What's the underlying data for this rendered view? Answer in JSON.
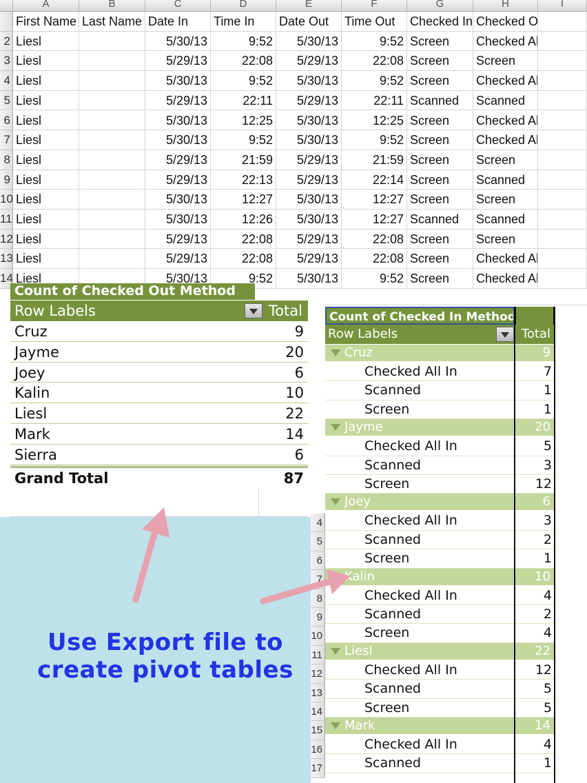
{
  "spreadsheet": {
    "column_letters": [
      "A",
      "B",
      "C",
      "D",
      "E",
      "F",
      "G",
      "H",
      "I"
    ],
    "row_numbers_top": [
      "2",
      "3",
      "4",
      "5",
      "6",
      "7",
      "8",
      "9",
      "10",
      "11",
      "12",
      "13",
      "14"
    ],
    "headers": [
      "First Name",
      "Last Name",
      "Date In",
      "Time In",
      "Date Out",
      "Time Out",
      "Checked In M",
      "Checked Out Method"
    ],
    "rows": [
      [
        "Liesl",
        "",
        "5/30/13",
        "9:52",
        "5/30/13",
        "9:52",
        "Screen",
        "Checked All In"
      ],
      [
        "Liesl",
        "",
        "5/29/13",
        "22:08",
        "5/29/13",
        "22:08",
        "Screen",
        "Screen"
      ],
      [
        "Liesl",
        "",
        "5/30/13",
        "9:52",
        "5/30/13",
        "9:52",
        "Screen",
        "Checked All In"
      ],
      [
        "Liesl",
        "",
        "5/29/13",
        "22:11",
        "5/29/13",
        "22:11",
        "Scanned",
        "Scanned"
      ],
      [
        "Liesl",
        "",
        "5/30/13",
        "12:25",
        "5/30/13",
        "12:25",
        "Screen",
        "Checked All In"
      ],
      [
        "Liesl",
        "",
        "5/30/13",
        "9:52",
        "5/30/13",
        "9:52",
        "Screen",
        "Checked All In"
      ],
      [
        "Liesl",
        "",
        "5/29/13",
        "21:59",
        "5/29/13",
        "21:59",
        "Screen",
        "Screen"
      ],
      [
        "Liesl",
        "",
        "5/29/13",
        "22:13",
        "5/29/13",
        "22:14",
        "Screen",
        "Scanned"
      ],
      [
        "Liesl",
        "",
        "5/30/13",
        "12:27",
        "5/30/13",
        "12:27",
        "Screen",
        "Screen"
      ],
      [
        "Liesl",
        "",
        "5/30/13",
        "12:26",
        "5/30/13",
        "12:27",
        "Scanned",
        "Scanned"
      ],
      [
        "Liesl",
        "",
        "5/29/13",
        "22:08",
        "5/29/13",
        "22:08",
        "Screen",
        "Screen"
      ],
      [
        "Liesl",
        "",
        "5/29/13",
        "22:08",
        "5/29/13",
        "22:08",
        "Screen",
        "Checked All In"
      ],
      [
        "Liesl",
        "",
        "5/30/13",
        "9:52",
        "5/30/13",
        "9:52",
        "Screen",
        "Checked All In"
      ]
    ],
    "row_numbers_right": [
      "4",
      "5",
      "6",
      "7",
      "8",
      "9",
      "10",
      "11",
      "12",
      "13",
      "14",
      "15",
      "16",
      "17"
    ]
  },
  "pivot_out": {
    "title": "Count of Checked Out Method",
    "row_labels_header": "Row Labels",
    "total_header": "Total",
    "rows": [
      {
        "label": "Cruz",
        "value": "9"
      },
      {
        "label": "Jayme",
        "value": "20"
      },
      {
        "label": "Joey",
        "value": "6"
      },
      {
        "label": "Kalin",
        "value": "10"
      },
      {
        "label": "Liesl",
        "value": "22"
      },
      {
        "label": "Mark",
        "value": "14"
      },
      {
        "label": "Sierra",
        "value": "6"
      }
    ],
    "grand_total_label": "Grand Total",
    "grand_total_value": "87"
  },
  "pivot_in": {
    "title": "Count of Checked In Method",
    "row_labels_header": "Row Labels",
    "total_header": "Total",
    "groups": [
      {
        "label": "Cruz",
        "value": "9",
        "items": [
          {
            "label": "Checked All In",
            "value": "7"
          },
          {
            "label": "Scanned",
            "value": "1"
          },
          {
            "label": "Screen",
            "value": "1"
          }
        ]
      },
      {
        "label": "Jayme",
        "value": "20",
        "items": [
          {
            "label": "Checked All In",
            "value": "5"
          },
          {
            "label": "Scanned",
            "value": "3"
          },
          {
            "label": "Screen",
            "value": "12"
          }
        ]
      },
      {
        "label": "Joey",
        "value": "6",
        "items": [
          {
            "label": "Checked All In",
            "value": "3"
          },
          {
            "label": "Scanned",
            "value": "2"
          },
          {
            "label": "Screen",
            "value": "1"
          }
        ]
      },
      {
        "label": "Kalin",
        "value": "10",
        "items": [
          {
            "label": "Checked All In",
            "value": "4"
          },
          {
            "label": "Scanned",
            "value": "2"
          },
          {
            "label": "Screen",
            "value": "4"
          }
        ]
      },
      {
        "label": "Liesl",
        "value": "22",
        "items": [
          {
            "label": "Checked All In",
            "value": "12"
          },
          {
            "label": "Scanned",
            "value": "5"
          },
          {
            "label": "Screen",
            "value": "5"
          }
        ]
      },
      {
        "label": "Mark",
        "value": "14",
        "items": [
          {
            "label": "Checked All In",
            "value": "4"
          },
          {
            "label": "Scanned",
            "value": "1"
          }
        ]
      }
    ]
  },
  "callout": {
    "line1": "Use Export file to",
    "line2": "create pivot tables"
  },
  "colors": {
    "pivot_header": "#76933c",
    "pivot_group": "#c4d79b",
    "callout_bg": "#bfe1ea",
    "callout_text": "#2233e6",
    "arrow": "#e8a1ae"
  }
}
